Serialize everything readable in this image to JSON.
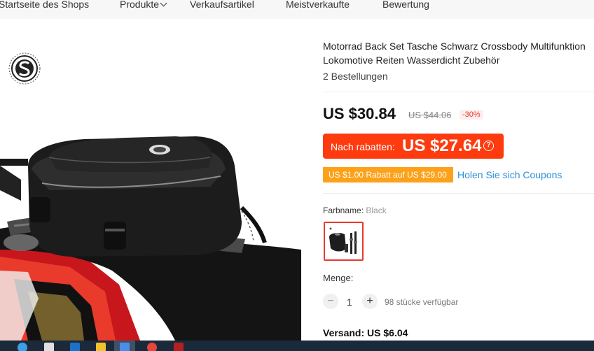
{
  "nav": {
    "items": [
      "Startseite des Shops",
      "Produkte",
      "Verkaufsartikel",
      "Meistverkaufte",
      "Bewertung"
    ]
  },
  "product": {
    "title_line1": "Motorrad Back Set Tasche Schwarz Crossbody Multifunktion",
    "title_line2": "Lokomotive Reiten Wasserdicht Zubehör",
    "orders": "2 Bestellungen",
    "price": "US $30.84",
    "original_price": "US $44.06",
    "discount": "-30%",
    "after_discount_label": "Nach rabatten:",
    "after_discount_price": "US $27.64",
    "after_discount_icon": "question-icon",
    "coupon_tag": "US $1.00 Rabatt auf US $29.00",
    "coupon_link": "Holen Sie sich Coupons",
    "color_label": "Farbname:",
    "color_value": "Black",
    "quantity_label": "Menge:",
    "quantity_value": "1",
    "minus_symbol": "−",
    "plus_symbol": "+",
    "stock": "98 stücke verfügbar",
    "shipping": "Versand: US $6.04"
  },
  "colors": {
    "accent_red": "#fd3b0f",
    "coupon_orange": "#fca119",
    "link_blue": "#2d8fd8"
  }
}
